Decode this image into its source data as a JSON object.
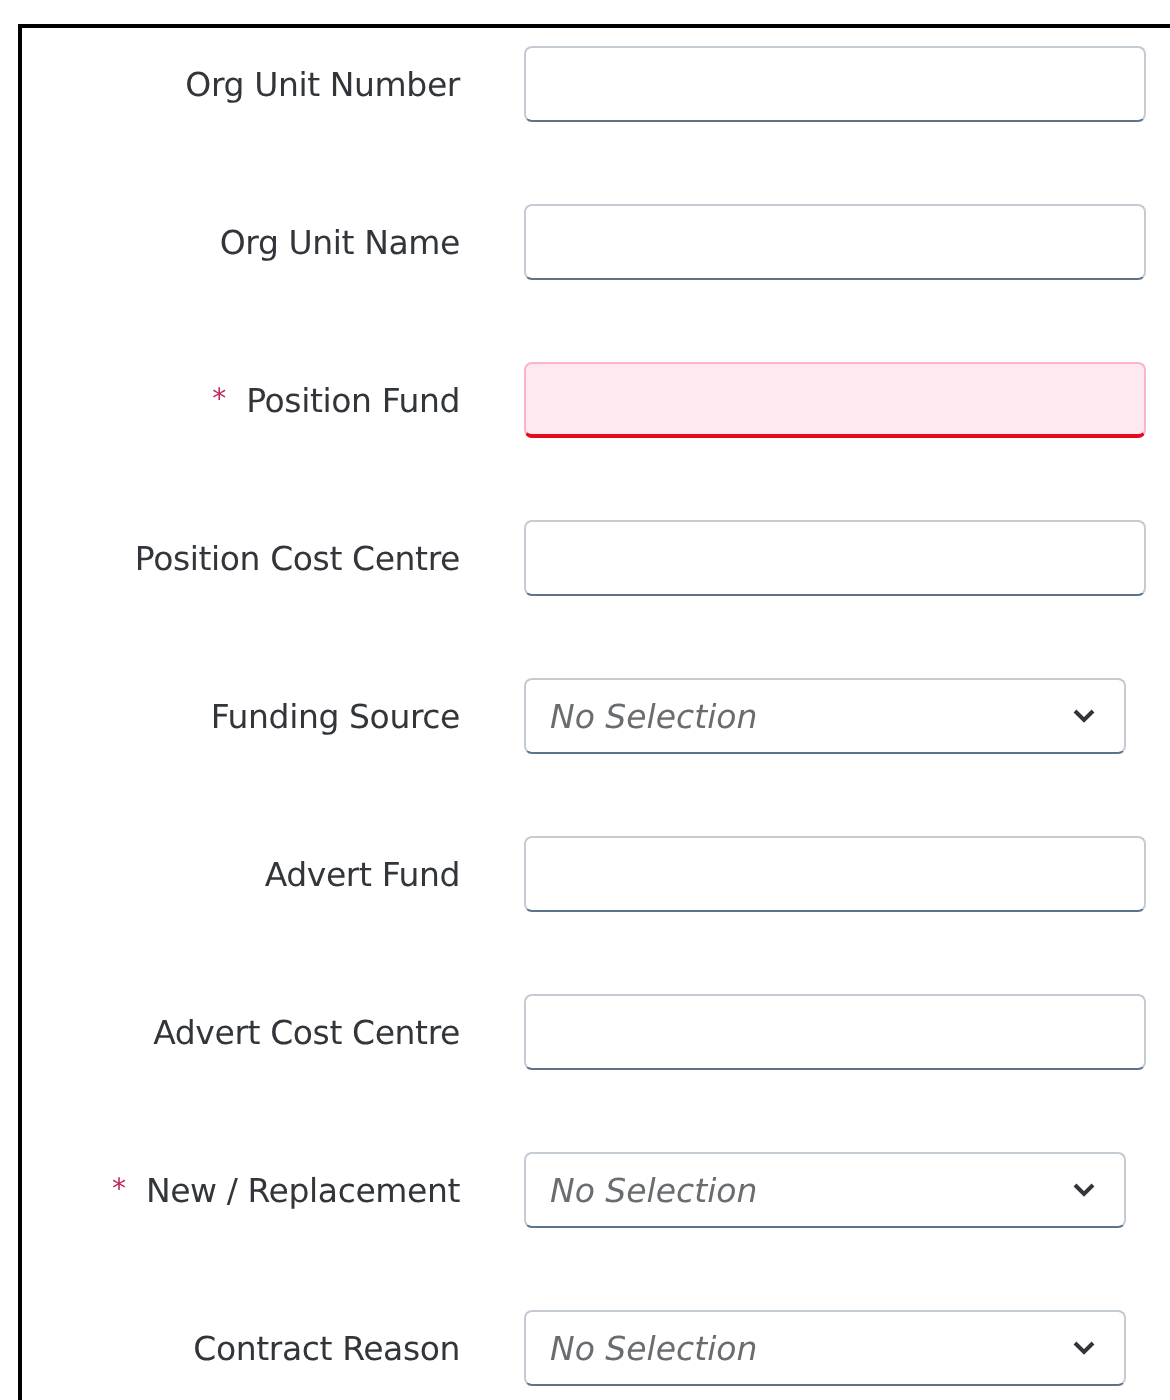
{
  "form": {
    "fields": [
      {
        "label": "Org Unit Number",
        "kind": "input",
        "error": false
      },
      {
        "label": "Org Unit Name",
        "kind": "input",
        "error": false
      },
      {
        "label": "Position Fund",
        "kind": "input",
        "required_mark": "*",
        "error": true
      },
      {
        "label": "Position Cost Centre",
        "kind": "input",
        "error": false
      },
      {
        "label": "Funding Source",
        "kind": "select",
        "placeholder": "No Selection",
        "error": false
      },
      {
        "label": "Advert Fund",
        "kind": "input",
        "error": false
      },
      {
        "label": "Advert Cost Centre",
        "kind": "input",
        "error": false
      },
      {
        "label": "New / Replacement",
        "kind": "select",
        "required_mark": "*",
        "placeholder": "No Selection",
        "error": false
      },
      {
        "label": "Contract Reason",
        "kind": "select",
        "placeholder": "No Selection",
        "error": false
      }
    ]
  }
}
